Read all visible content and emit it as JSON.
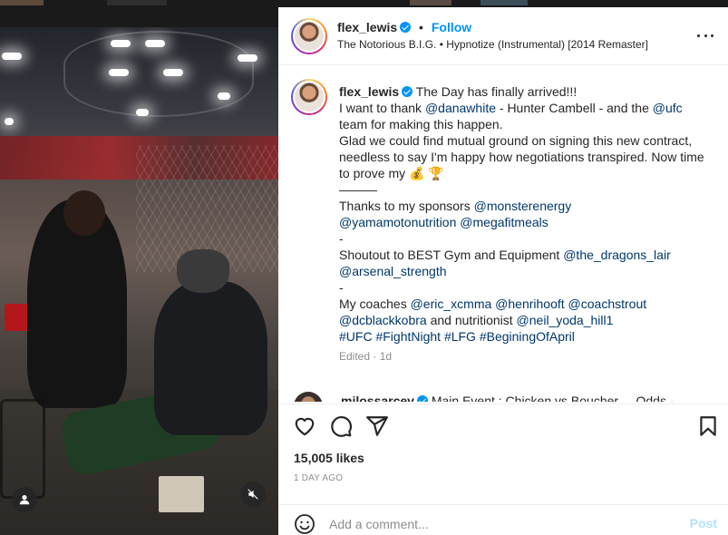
{
  "post": {
    "username": "flex_lewis",
    "follow_label": "Follow",
    "separator": "•",
    "audio": "The Notorious B.I.G. • Hypnotize (Instrumental) [2014 Remaster]",
    "caption": {
      "username": "flex_lewis",
      "line1": "The Day has finally arrived!!!",
      "line2_pre": "I want to thank ",
      "line2_mention1": "@danawhite",
      "line2_mid": " - Hunter Cambell - and the ",
      "line2_mention2": "@ufc",
      "line3": "team for making this happen.",
      "line4": "Glad we could find mutual ground on signing this new contract, needless to say I'm happy how negotiations transpired. Now time to prove my 💰 🏆",
      "divider": "———",
      "sponsors_pre": "Thanks to my sponsors ",
      "sponsors_m1": "@monsterenergy",
      "sponsors_m2": "@yamamotonutrition",
      "sponsors_m3": "@megafitmeals",
      "dash1": "-",
      "gym_pre": "Shoutout to BEST Gym and Equipment ",
      "gym_m1": "@the_dragons_lair",
      "gym_m2": "@arsenal_strength",
      "dash2": "-",
      "coaches_pre": "My coaches ",
      "coaches_m1": "@eric_xcmma",
      "coaches_m2": "@henrihooft",
      "coaches_m3": "@coachstrout",
      "coaches_m4": "@dcblackkobra",
      "coaches_mid": " and nutritionist ",
      "coaches_m5": "@neil_yoda_hill1",
      "hashtags": [
        "#UFC",
        "#FightNight",
        "#LFG",
        "#BeginingOfApril"
      ],
      "edited": "Edited · 1d"
    },
    "next_comment": {
      "username": "milossarcev",
      "text": "Main Event : Chicken vs Boucher ... Odds -"
    },
    "likes": "15,005 likes",
    "time": "1 DAY AGO",
    "comment_placeholder": "Add a comment...",
    "post_label": "Post"
  },
  "colors": {
    "accent": "#0095f6",
    "mention": "#00376b",
    "post_disabled": "#b2dffc"
  }
}
